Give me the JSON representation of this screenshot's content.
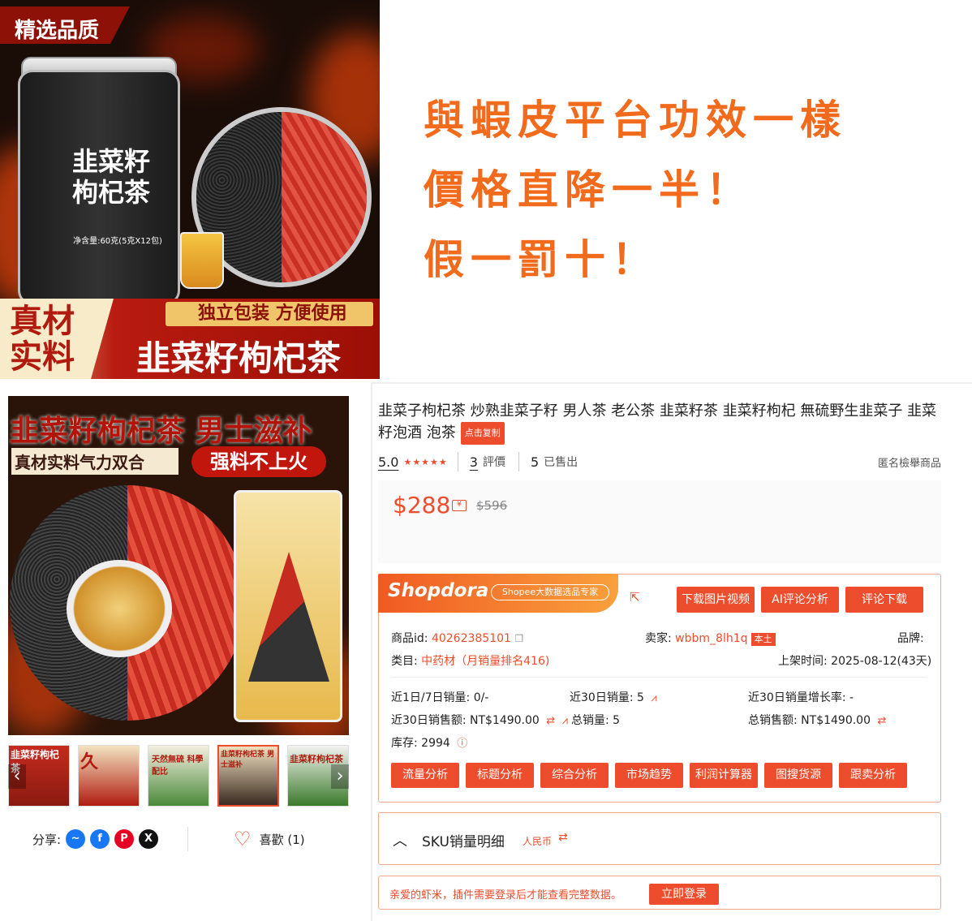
{
  "banner": {
    "quality_tag": "精选品质",
    "jar_label": "韭菜籽枸杞茶",
    "jar_net": "净含量:60克(5克X12包)",
    "ribbon_left": "真材实料",
    "ribbon_sub": "独立包装 方便使用",
    "ribbon_main": "韭菜籽枸杞茶",
    "slogans": [
      "與蝦皮平台功效一樣",
      "價格直降一半！",
      "假一罰十！"
    ]
  },
  "main_image": {
    "title": "韭菜籽枸杞茶 男士滋补",
    "sub": "真材实料气力双合",
    "badge": "强料不上火"
  },
  "thumbnails": [
    {
      "caption": "韭菜籽枸杞茶",
      "active": false
    },
    {
      "caption": "久",
      "active": false
    },
    {
      "caption": "天然無硫 科學配比",
      "active": false
    },
    {
      "caption": "韭菜籽枸杞茶 男士滋补",
      "active": true
    },
    {
      "caption": "韭菜籽枸杞茶",
      "active": false
    }
  ],
  "share": {
    "label": "分享:",
    "icons": [
      "messenger-icon",
      "facebook-icon",
      "pinterest-icon",
      "x-icon"
    ],
    "like_label": "喜歡 (1)"
  },
  "product": {
    "title": "韭菜子枸杞茶 炒熟韭菜子籽 男人茶 老公茶 韭菜籽茶 韭菜籽枸杞 無硫野生韭菜子 韭菜籽泡酒 泡茶",
    "copy_label": "点击复制",
    "rating": "5.0",
    "stars": "★★★★★",
    "reviews_count": "3",
    "reviews_label": "評價",
    "sold_count": "5",
    "sold_label": "已售出",
    "report": "匿名檢舉商品",
    "price_now": "$288",
    "price_old": "$596"
  },
  "shopdora": {
    "brand": "Shopdora",
    "badge": "Shopee大数据选品专家",
    "buttons": [
      "下载图片视频",
      "AI评论分析",
      "评论下载"
    ],
    "item_id_label": "商品id:",
    "item_id": "40262385101",
    "seller_label": "卖家:",
    "seller": "wbbm_8lh1q",
    "local_tag": "本土",
    "brand_label": "品牌:",
    "category_label": "类目:",
    "category": "中药材（月销量排名416)",
    "listed_label": "上架时间:",
    "listed": "2025-08-12(43天)",
    "stats": {
      "sales_1_7_label": "近1日/7日销量:",
      "sales_1_7": "0/-",
      "sales_30_label": "近30日销量:",
      "sales_30": "5",
      "growth_30_label": "近30日销量增长率:",
      "growth_30": "-",
      "revenue_30_label": "近30日销售额:",
      "revenue_30": "NT$1490.00",
      "total_sales_label": "总销量:",
      "total_sales": "5",
      "total_revenue_label": "总销售额:",
      "total_revenue": "NT$1490.00",
      "stock_label": "库存:",
      "stock": "2994"
    },
    "tools": [
      "流量分析",
      "标题分析",
      "综合分析",
      "市场趋势",
      "利润计算器",
      "图搜货源",
      "跟卖分析"
    ]
  },
  "sku": {
    "title": "SKU销量明细",
    "currency": "人民币"
  },
  "login": {
    "text": "亲爱的虾米，插件需要登录后才能查看完整数据。",
    "button": "立即登录"
  },
  "colors": {
    "accent": "#ee4d2d",
    "slogan": "#f26a1b"
  }
}
